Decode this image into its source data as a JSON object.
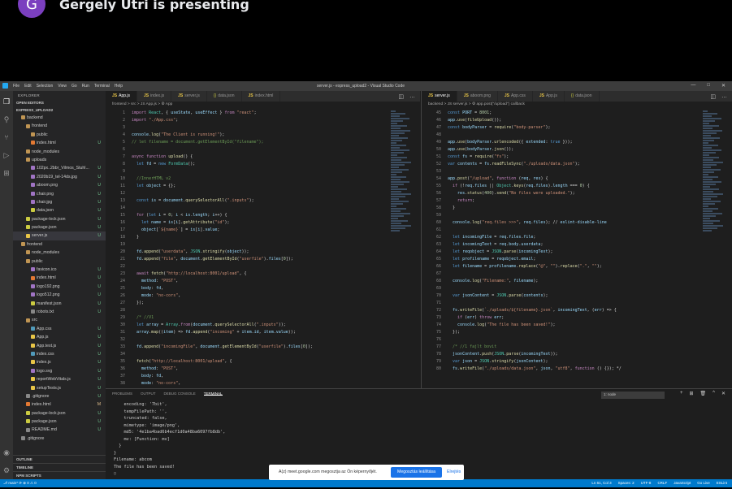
{
  "meet": {
    "avatar_letter": "G",
    "presenter_text": "Gergely Utri is presenting"
  },
  "window": {
    "title": "server.js - express_upload2 - Visual Studio Code",
    "menu": [
      "File",
      "Edit",
      "Selection",
      "View",
      "Go",
      "Run",
      "Terminal",
      "Help"
    ],
    "controls": [
      "—",
      "□",
      "✕"
    ]
  },
  "activity_icons": [
    "explorer-icon",
    "search-icon",
    "source-control-icon",
    "run-debug-icon",
    "extensions-icon",
    "accounts-icon",
    "settings-icon"
  ],
  "sidebar": {
    "header": "EXPLORER",
    "open_editors": "OPEN EDITORS",
    "project": "EXPRESS_UPLOAD2",
    "tree": [
      {
        "label": "backend",
        "indent": 1,
        "kind": "folder"
      },
      {
        "label": "frontend",
        "indent": 2,
        "kind": "folder"
      },
      {
        "label": "public",
        "indent": 3,
        "kind": "folder"
      },
      {
        "label": "index.html",
        "indent": 3,
        "kind": "html",
        "status": "U"
      },
      {
        "label": "node_modules",
        "indent": 2,
        "kind": "folder"
      },
      {
        "label": "uploads",
        "indent": 2,
        "kind": "folder"
      },
      {
        "label": "102px..2bbr_Vilmos_Stuhl...",
        "indent": 3,
        "kind": "img",
        "status": "U"
      },
      {
        "label": "2020b19_tel-14ds.jpg",
        "indent": 3,
        "kind": "img",
        "status": "U"
      },
      {
        "label": "aboom.png",
        "indent": 3,
        "kind": "img",
        "status": "U"
      },
      {
        "label": "chair.png",
        "indent": 3,
        "kind": "img",
        "status": "U"
      },
      {
        "label": "chair.jpg",
        "indent": 3,
        "kind": "img",
        "status": "U"
      },
      {
        "label": "data.json",
        "indent": 3,
        "kind": "json",
        "status": "U"
      },
      {
        "label": "package-lock.json",
        "indent": 2,
        "kind": "json",
        "status": "U"
      },
      {
        "label": "package.json",
        "indent": 2,
        "kind": "json",
        "status": "U"
      },
      {
        "label": "server.js",
        "indent": 2,
        "kind": "js",
        "status": "U",
        "selected": true
      },
      {
        "label": "frontend",
        "indent": 1,
        "kind": "folder"
      },
      {
        "label": "node_modules",
        "indent": 2,
        "kind": "folder"
      },
      {
        "label": "public",
        "indent": 2,
        "kind": "folder"
      },
      {
        "label": "favicon.ico",
        "indent": 3,
        "kind": "img",
        "status": "U"
      },
      {
        "label": "index.html",
        "indent": 3,
        "kind": "html",
        "status": "U"
      },
      {
        "label": "logo192.png",
        "indent": 3,
        "kind": "img",
        "status": "U"
      },
      {
        "label": "logo512.png",
        "indent": 3,
        "kind": "img",
        "status": "U"
      },
      {
        "label": "manifest.json",
        "indent": 3,
        "kind": "json",
        "status": "U"
      },
      {
        "label": "robots.txt",
        "indent": 3,
        "kind": "txt",
        "status": "U"
      },
      {
        "label": "src",
        "indent": 2,
        "kind": "folder"
      },
      {
        "label": "App.css",
        "indent": 3,
        "kind": "css",
        "status": "U"
      },
      {
        "label": "App.js",
        "indent": 3,
        "kind": "js",
        "status": "U"
      },
      {
        "label": "App.test.js",
        "indent": 3,
        "kind": "js",
        "status": "U"
      },
      {
        "label": "index.css",
        "indent": 3,
        "kind": "css",
        "status": "U"
      },
      {
        "label": "index.js",
        "indent": 3,
        "kind": "js",
        "status": "U"
      },
      {
        "label": "logo.svg",
        "indent": 3,
        "kind": "img",
        "status": "U"
      },
      {
        "label": "reportWebVitals.js",
        "indent": 3,
        "kind": "js",
        "status": "U"
      },
      {
        "label": "setupTests.js",
        "indent": 3,
        "kind": "js",
        "status": "U"
      },
      {
        "label": ".gitignore",
        "indent": 2,
        "kind": "txt",
        "status": "U"
      },
      {
        "label": "index.html",
        "indent": 2,
        "kind": "html",
        "status": "M"
      },
      {
        "label": "package-lock.json",
        "indent": 2,
        "kind": "json",
        "status": "U"
      },
      {
        "label": "package.json",
        "indent": 2,
        "kind": "json",
        "status": "U"
      },
      {
        "label": "README.md",
        "indent": 2,
        "kind": "txt",
        "status": "U"
      },
      {
        "label": ".gitignore",
        "indent": 1,
        "kind": "txt"
      }
    ],
    "bottom": [
      "OUTLINE",
      "TIMELINE",
      "NPM SCRIPTS"
    ]
  },
  "left_editor": {
    "tabs": [
      "App.js",
      "index.js",
      "server.js",
      "data.json",
      "index.html"
    ],
    "active_tab": 0,
    "breadcrumb": "frontend > src > JS App.js > ⚙ App",
    "lines": [
      {
        "n": "1",
        "t": "import React, { useState, useEffect } from \"react\";"
      },
      {
        "n": "2",
        "t": "import \"./App.css\";"
      },
      {
        "n": "3",
        "t": ""
      },
      {
        "n": "4",
        "t": "console.log(\"The Client is running!\");"
      },
      {
        "n": "5",
        "t": "// let filename = document.getElementById(\"filename\");"
      },
      {
        "n": "6",
        "t": ""
      },
      {
        "n": "7",
        "t": "async function upload() {"
      },
      {
        "n": "8",
        "t": "  let fd = new FormData();"
      },
      {
        "n": "9",
        "t": ""
      },
      {
        "n": "10",
        "t": "  //InnerHTML v2"
      },
      {
        "n": "11",
        "t": "  let object = {};"
      },
      {
        "n": "12",
        "t": ""
      },
      {
        "n": "13",
        "t": "  const is = document.querySelectorAll(\".inputs\");"
      },
      {
        "n": "14",
        "t": ""
      },
      {
        "n": "15",
        "t": "  for (let i = 0; i < is.length; i++) {"
      },
      {
        "n": "16",
        "t": "    let name = is[i].getAttribute(\"id\");"
      },
      {
        "n": "17",
        "t": "    object[`${name}`] = is[i].value;"
      },
      {
        "n": "18",
        "t": "  }"
      },
      {
        "n": "19",
        "t": ""
      },
      {
        "n": "20",
        "t": "  fd.append(\"userdata\", JSON.stringify(object));"
      },
      {
        "n": "21",
        "t": "  fd.append(\"file\", document.getElementById(\"userfile\").files[0]);"
      },
      {
        "n": "22",
        "t": ""
      },
      {
        "n": "23",
        "t": "  await fetch(\"http://localhost:8001/upload\", {"
      },
      {
        "n": "24",
        "t": "    method: \"POST\","
      },
      {
        "n": "25",
        "t": "    body: fd,"
      },
      {
        "n": "26",
        "t": "    mode: \"no-cors\","
      },
      {
        "n": "27",
        "t": "  });"
      },
      {
        "n": "28",
        "t": ""
      },
      {
        "n": "29",
        "t": "  /* //V1"
      },
      {
        "n": "30",
        "t": "  let array = Array.from(document.querySelectorAll(\".inputs\"));"
      },
      {
        "n": "31",
        "t": "  array.map((item) => fd.append(\"incoming\" + item.id, item.value));"
      },
      {
        "n": "32",
        "t": ""
      },
      {
        "n": "33",
        "t": "  fd.append(\"incomingFile\", document.getElementById(\"userfile\").files[0]);"
      },
      {
        "n": "34",
        "t": ""
      },
      {
        "n": "35",
        "t": "  fetch(\"http://localhost:8001/upload\", {"
      },
      {
        "n": "36",
        "t": "    method: \"POST\","
      },
      {
        "n": "37",
        "t": "    body: fd,"
      },
      {
        "n": "38",
        "t": "    mode: \"no-cors\","
      }
    ]
  },
  "right_editor": {
    "tabs": [
      "server.js",
      "aboom.png",
      "App.css",
      "App.js",
      "data.json"
    ],
    "active_tab": 0,
    "breadcrumb": "backend > JS server.js > ⚙ app.post(\"/upload\") callback",
    "lines": [
      {
        "n": "45",
        "t": "const PORT = 8001;"
      },
      {
        "n": "46",
        "t": "app.use(fileUpload());"
      },
      {
        "n": "47",
        "t": "const bodyParser = require(\"body-parser\");"
      },
      {
        "n": "48",
        "t": ""
      },
      {
        "n": "49",
        "t": "app.use(bodyParser.urlencoded({ extended: true }));"
      },
      {
        "n": "50",
        "t": "app.use(bodyParser.json());"
      },
      {
        "n": "51",
        "t": "const fs = require(\"fs\");"
      },
      {
        "n": "52",
        "t": "var contents = fs.readFileSync(\"./uploads/data.json\");"
      },
      {
        "n": "53",
        "t": ""
      },
      {
        "n": "54",
        "t": "app.post(\"/upload\", function (req, res) {"
      },
      {
        "n": "55",
        "t": "  if (!req.files || Object.keys(req.files).length === 0) {"
      },
      {
        "n": "56",
        "t": "    res.status(400).send(\"No files were uploaded.\");"
      },
      {
        "n": "57",
        "t": "    return;"
      },
      {
        "n": "58",
        "t": "  }"
      },
      {
        "n": "59",
        "t": ""
      },
      {
        "n": "60",
        "t": "  console.log(\"req.files >>>\", req.files); // eslint-disable-line"
      },
      {
        "n": "61",
        "t": ""
      },
      {
        "n": "62",
        "t": "  let incomingFile = req.files.file;"
      },
      {
        "n": "63",
        "t": "  let incomingText = req.body.userdata;"
      },
      {
        "n": "64",
        "t": "  let reqobject = JSON.parse(incomingText);"
      },
      {
        "n": "65",
        "t": "  let profilename = reqobject.email;"
      },
      {
        "n": "66",
        "t": "  let filename = profilename.replace(\"@\", \"\").replace(\".\", \"\");"
      },
      {
        "n": "67",
        "t": ""
      },
      {
        "n": "68",
        "t": "  console.log(\"Filename:\", filename);"
      },
      {
        "n": "69",
        "t": ""
      },
      {
        "n": "70",
        "t": "  var jsonContent = JSON.parse(contents);"
      },
      {
        "n": "71",
        "t": ""
      },
      {
        "n": "72",
        "t": "  fs.writeFile(`./uploads/${filename}.json`, incomingText, (err) => {"
      },
      {
        "n": "73",
        "t": "    if (err) throw err;"
      },
      {
        "n": "74",
        "t": "    console.log(\"The file has been saved!\");"
      },
      {
        "n": "75",
        "t": "  });"
      },
      {
        "n": "76",
        "t": ""
      },
      {
        "n": "77",
        "t": "  /* //1 fajlt bovit"
      },
      {
        "n": "78",
        "t": "  jsonContent.push(JSON.parse(incomingText));"
      },
      {
        "n": "79",
        "t": "  var json = JSON.stringify(jsonContent);"
      },
      {
        "n": "80",
        "t": "  fs.writeFile(\"./uploads/data.json\", json, \"utf8\", function () {}); */"
      }
    ]
  },
  "panel": {
    "tabs": [
      "PROBLEMS",
      "OUTPUT",
      "DEBUG CONSOLE",
      "TERMINAL"
    ],
    "active_tab": 3,
    "terminal_select": "1: node",
    "icons": [
      "+",
      "⊞",
      "🗑",
      "^",
      "✕"
    ],
    "terminal_lines": [
      "    encoding: '7bit',",
      "    tempFilePath: '',",
      "    truncated: false,",
      "    mimetype: 'image/png',",
      "    md5: '4e1ba4bad6b4ecf1d0a48ba6097fb8db',",
      "    mv: [Function: mv]",
      "  }",
      "}",
      "Filename: abcom",
      "The file has been saved!",
      "▯"
    ]
  },
  "statusbar": {
    "left": "⎇ main*   ⟳   ⊗ 0 ⚠ 0",
    "right": [
      "Ln 61, Col 3",
      "Spaces: 2",
      "UTF-8",
      "CRLF",
      "JavaScript",
      "Go Live",
      "ESLint"
    ]
  },
  "share_bar": {
    "text": "A(z) meet.google.com megosztja az Ön képernyőjét.",
    "stop_button": "Megosztás leállítása",
    "hide_link": "Elrejtés"
  },
  "colors": {
    "accent": "#007acc",
    "meet_avatar": "#7b3fbf",
    "stop_button": "#1a73e8"
  }
}
